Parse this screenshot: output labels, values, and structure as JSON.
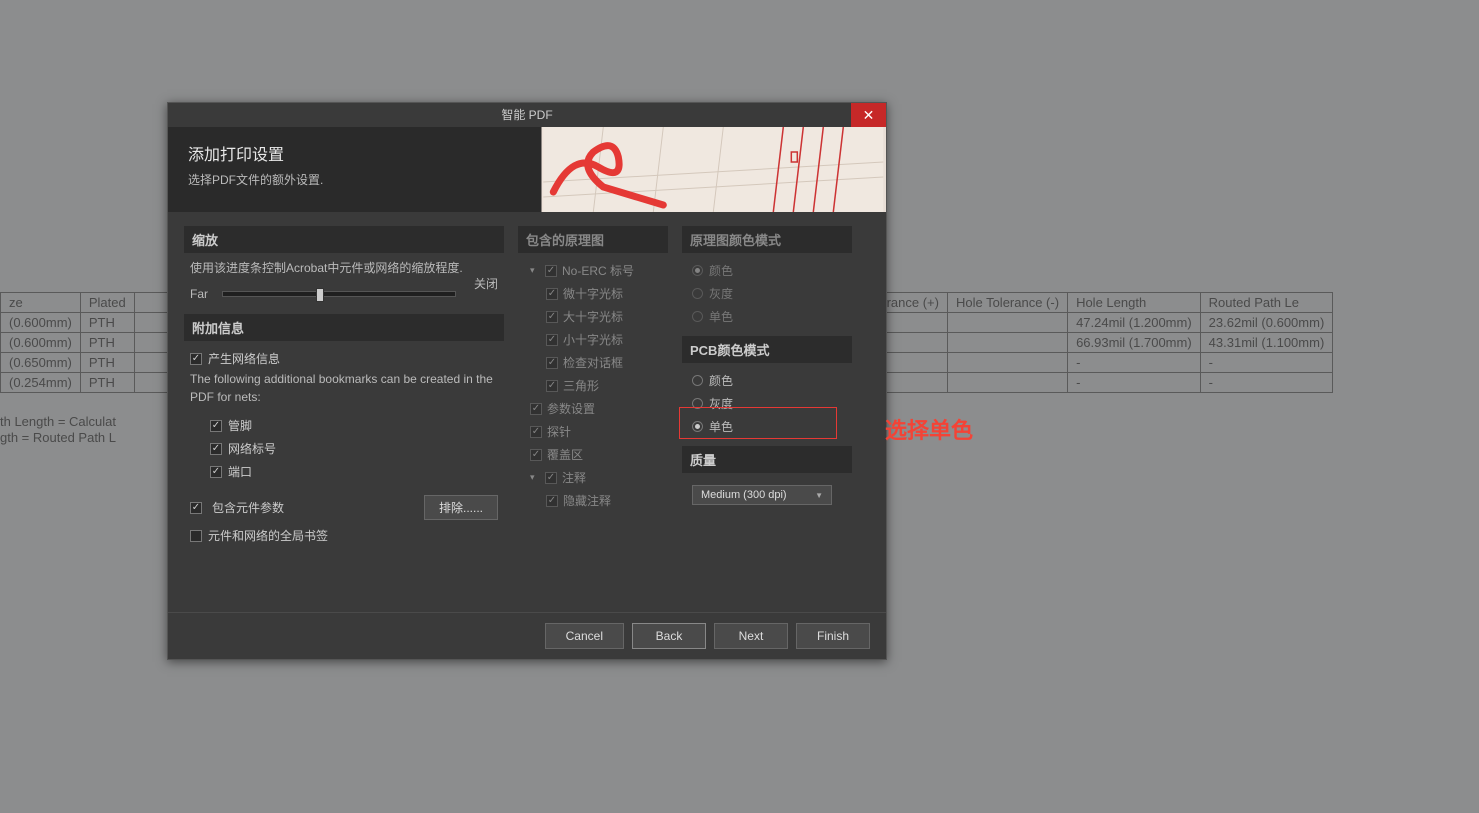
{
  "dialog": {
    "title": "智能 PDF",
    "header_title": "添加打印设置",
    "header_sub": "选择PDF文件的额外设置."
  },
  "zoom": {
    "header": "缩放",
    "desc": "使用该进度条控制Acrobat中元件或网络的缩放程度.",
    "far": "Far",
    "close": "关闭"
  },
  "additional": {
    "header": "附加信息",
    "generate_net": "产生网络信息",
    "desc": "The following additional bookmarks can be created in the PDF for nets:",
    "pins": "管脚",
    "netlabels": "网络标号",
    "ports": "端口",
    "include_params": "包含元件参数",
    "exclude_btn": "排除......",
    "global_bookmarks": "元件和网络的全局书签"
  },
  "included_sch": {
    "header": "包含的原理图",
    "no_erc": "No-ERC 标号",
    "micro_cross": "微十字光标",
    "large_cross": "大十字光标",
    "small_cross": "小十字光标",
    "check_box": "检查对话框",
    "triangle": "三角形",
    "param_settings": "参数设置",
    "probes": "探针",
    "blankets": "覆盖区",
    "notes": "注释",
    "hidden_notes": "隐藏注释"
  },
  "sch_color": {
    "header": "原理图颜色模式",
    "color": "颜色",
    "grey": "灰度",
    "mono": "单色"
  },
  "pcb_color": {
    "header": "PCB颜色模式",
    "color": "颜色",
    "grey": "灰度",
    "mono": "单色"
  },
  "quality": {
    "header": "质量",
    "selected": "Medium (300 dpi)"
  },
  "footer": {
    "cancel": "Cancel",
    "back": "Back",
    "next": "Next",
    "finish": "Finish"
  },
  "annotation": "选择单色",
  "bg_table": {
    "headers": [
      "ze",
      "Plated",
      "",
      "Tolerance (+)",
      "Hole Tolerance (-)",
      "Hole Length",
      "Routed Path Le"
    ],
    "rows": [
      [
        "(0.600mm)",
        "PTH",
        "",
        "",
        "",
        "47.24mil (1.200mm)",
        "23.62mil (0.600mm)"
      ],
      [
        "(0.600mm)",
        "PTH",
        "",
        "",
        "",
        "66.93mil (1.700mm)",
        "43.31mil (1.100mm)"
      ],
      [
        "(0.650mm)",
        "PTH",
        "",
        "",
        "",
        "-",
        "-"
      ],
      [
        "(0.254mm)",
        "PTH",
        "",
        "",
        "",
        "-",
        "-"
      ]
    ]
  },
  "bg_footer": {
    "line1": "th Length = Calculat",
    "line2": "gth  = Routed Path L"
  }
}
